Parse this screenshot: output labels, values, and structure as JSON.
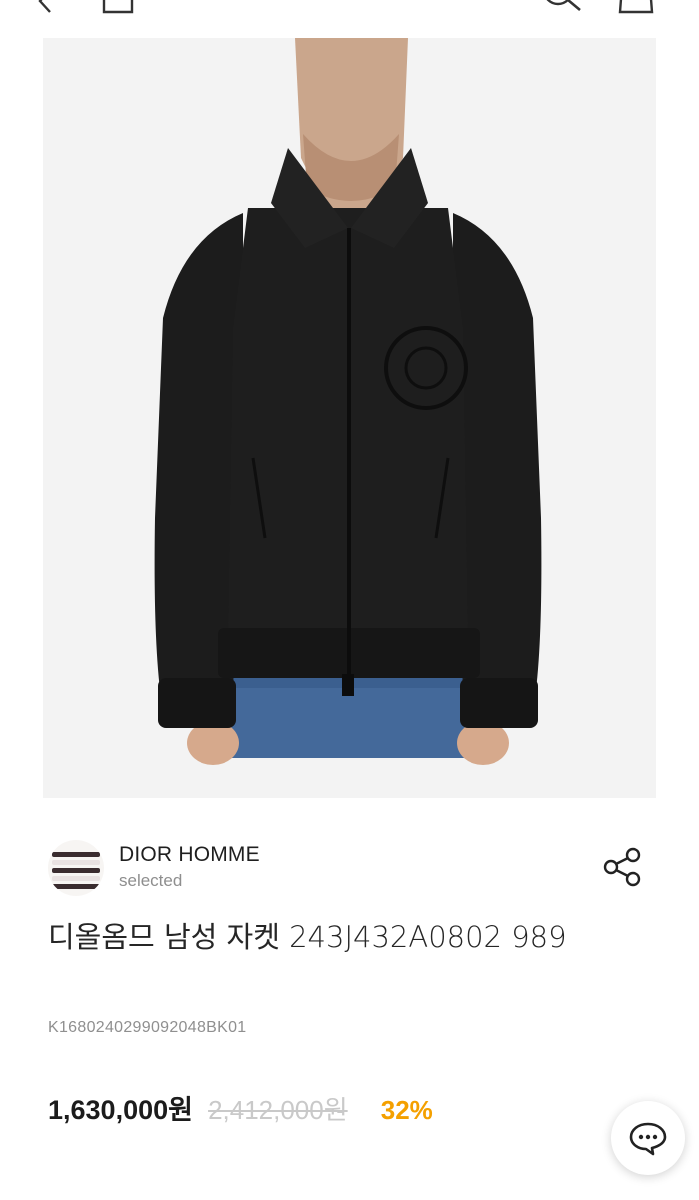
{
  "header": {
    "icons": [
      "back-icon",
      "home-icon",
      "search-icon",
      "shopping-bag-icon"
    ]
  },
  "product": {
    "image_alt": "black zip jacket",
    "brand": {
      "name": "DIOR HOMME",
      "subtitle": "selected"
    },
    "title": "디올옴므 남성 자켓 243J432A0802 989",
    "code": "K1680240299092048BK01",
    "price": {
      "sale": "1,630,000원",
      "original": "2,412,000원",
      "discount": "32%"
    }
  },
  "colors": {
    "discount": "#f4a000",
    "text": "#1c1c1c",
    "muted": "#8f8f8f"
  }
}
